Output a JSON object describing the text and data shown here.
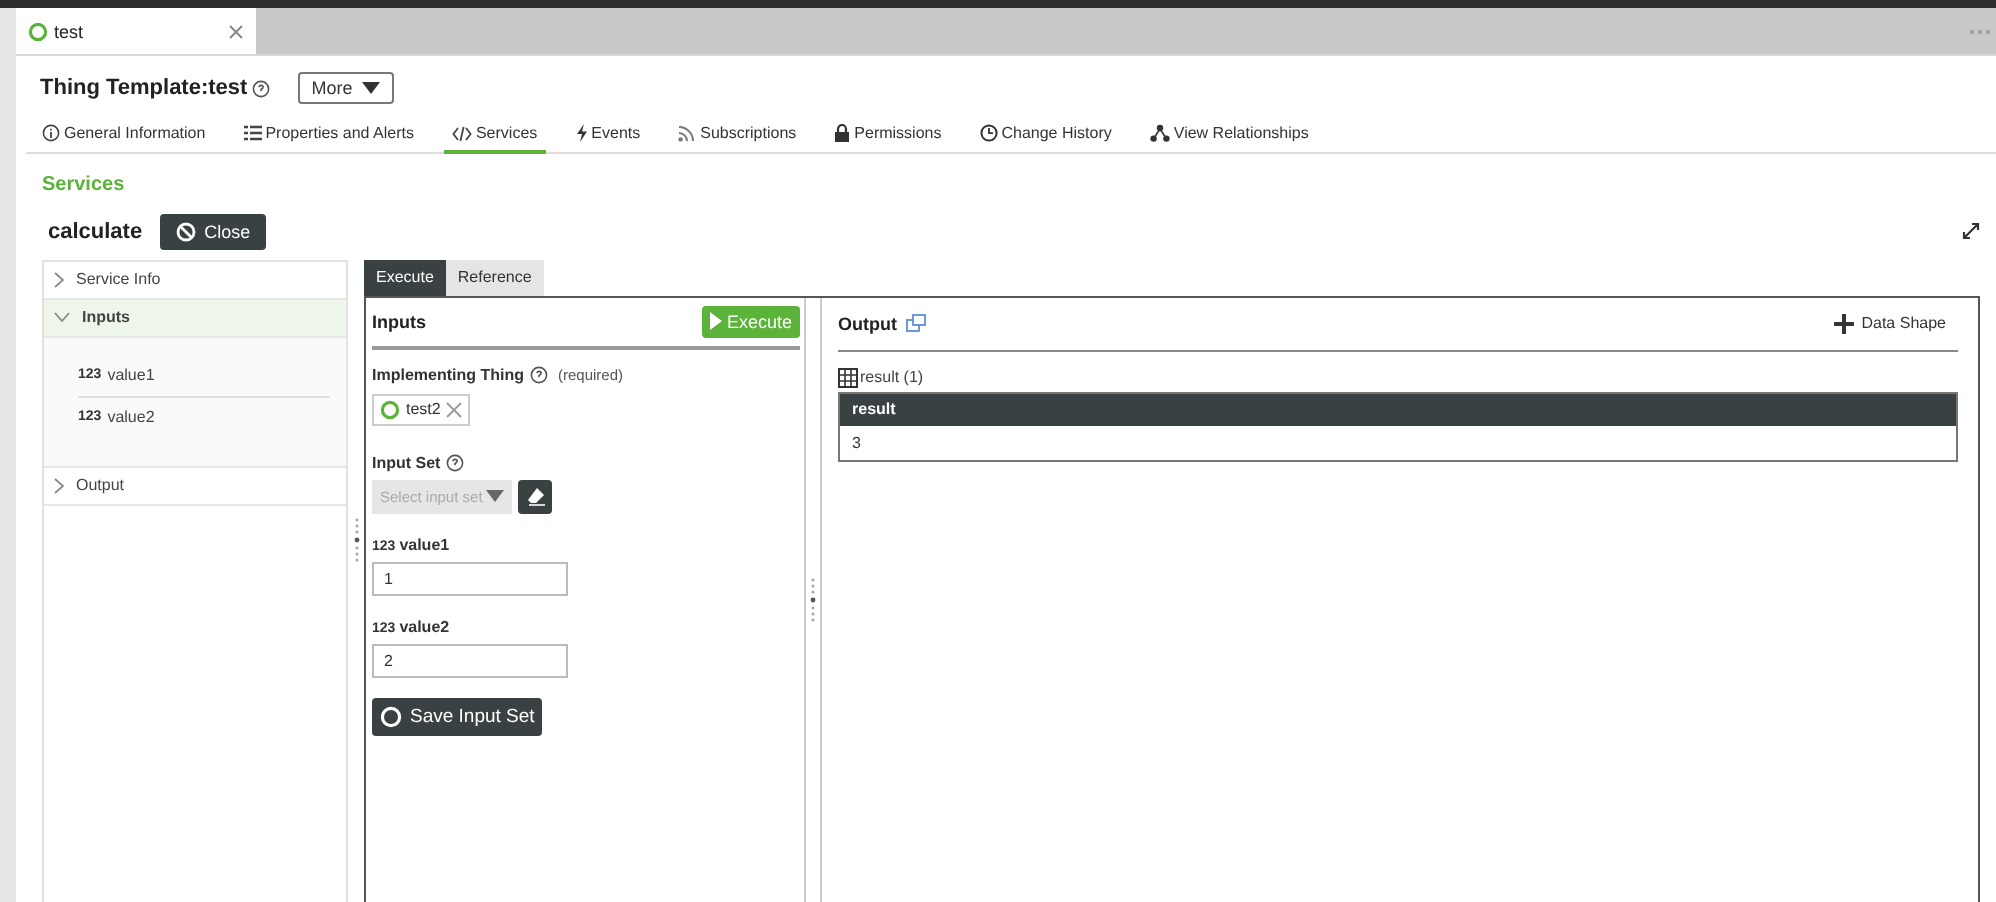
{
  "document_tab": {
    "label": "test",
    "selected": true
  },
  "header": {
    "title_prefix": "Thing Template:",
    "title_name": "test",
    "more_button": "More"
  },
  "nav_tabs": [
    {
      "label": "General Information",
      "kind": "info",
      "selected": false
    },
    {
      "label": "Properties and Alerts",
      "kind": "list",
      "selected": false
    },
    {
      "label": "Services",
      "kind": "code",
      "selected": true
    },
    {
      "label": "Events",
      "kind": "bolt",
      "selected": false
    },
    {
      "label": "Subscriptions",
      "kind": "feed",
      "selected": false
    },
    {
      "label": "Permissions",
      "kind": "lock",
      "selected": false
    },
    {
      "label": "Change History",
      "kind": "clock",
      "selected": false
    },
    {
      "label": "View Relationships",
      "kind": "graph",
      "selected": false
    }
  ],
  "section_title": "Services",
  "service": {
    "name": "calculate",
    "close_button": "Close"
  },
  "tree": [
    {
      "label": "Service Info",
      "expanded": false,
      "selected": false
    },
    {
      "label": "Inputs",
      "expanded": true,
      "selected": true,
      "children": [
        {
          "type_badge": "123",
          "label": "value1"
        },
        {
          "type_badge": "123",
          "label": "value2"
        }
      ]
    },
    {
      "label": "Output",
      "expanded": false,
      "selected": false
    }
  ],
  "panel_tabs": [
    {
      "label": "Execute",
      "selected": true
    },
    {
      "label": "Reference",
      "selected": false
    }
  ],
  "inputs": {
    "title": "Inputs",
    "execute_button": "Execute",
    "implementing_thing": {
      "label": "Implementing Thing",
      "note": "(required)",
      "value": "test2"
    },
    "input_set": {
      "label": "Input Set",
      "placeholder": "Select input set",
      "disabled": true
    },
    "parameters": [
      {
        "type_badge": "123",
        "label": "value1",
        "value": "1"
      },
      {
        "type_badge": "123",
        "label": "value2",
        "value": "2"
      }
    ],
    "save_button": "Save Input Set"
  },
  "output": {
    "title": "Output",
    "data_shape_button": "Data Shape",
    "table": {
      "title": "result",
      "count": "(1)",
      "columns": [
        "result"
      ],
      "rows": [
        [
          "3"
        ]
      ]
    }
  }
}
